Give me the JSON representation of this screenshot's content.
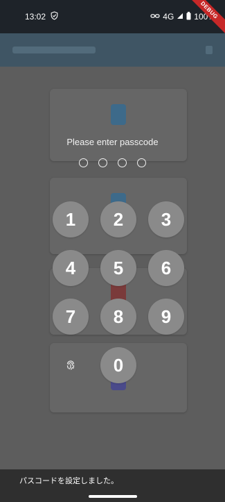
{
  "status_bar": {
    "time": "13:02",
    "network": "4G",
    "battery": "100%",
    "debug_label": "DEBUG",
    "icons": [
      "shield-check-icon",
      "link-icon",
      "signal-icon",
      "battery-icon"
    ]
  },
  "passcode": {
    "prompt": "Please enter passcode",
    "digits_entered": 0,
    "digits_total": 4
  },
  "keypad": {
    "keys": [
      "1",
      "2",
      "3",
      "4",
      "5",
      "6",
      "7",
      "8",
      "9",
      "0"
    ],
    "biometric_icon": "fingerprint-icon"
  },
  "snackbar": {
    "message": "パスコードを設定しました。"
  },
  "colors": {
    "key_background": "#8a8a8a",
    "overlay": "#5f5f5f",
    "status_bar": "#1e2329",
    "snackbar": "#2f2f2f"
  }
}
